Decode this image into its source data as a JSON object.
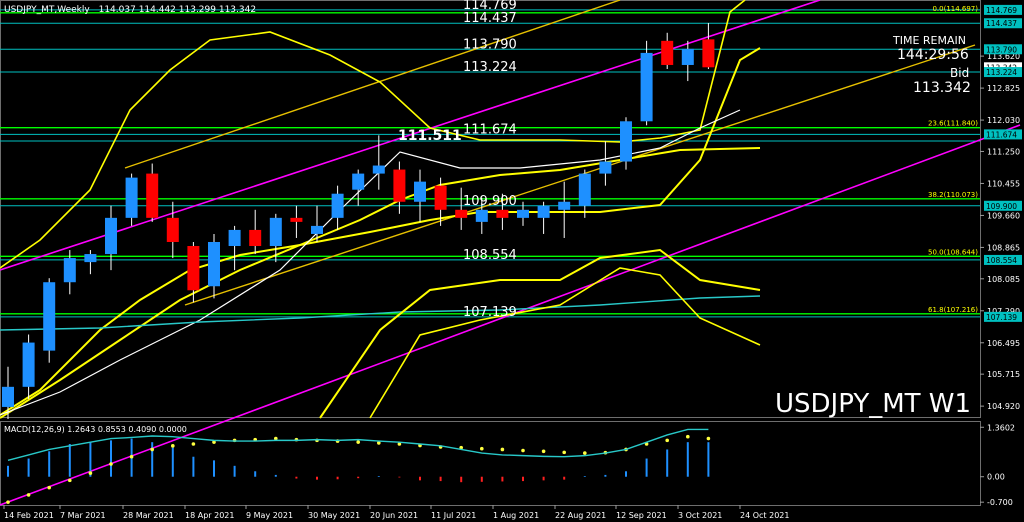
{
  "header": {
    "symbol_info": "USDJPY_MT,Weekly",
    "ohlc": "114.037 114.442 113.299 113.342"
  },
  "watermark": "USDJPY_MT W1",
  "info": {
    "time_remain_label": "TIME REMAIN",
    "time_remain": "144:29:56",
    "bid_label": "Bid",
    "bid": "113.342"
  },
  "macd": {
    "label": "MACD(12,26,9) 1.2643 0.8553 0.4090 0.0000",
    "ticks": [
      "1.3602",
      "0.00",
      "-0.700"
    ]
  },
  "colors": {
    "background": "#000000",
    "bull": "#1e90ff",
    "bear": "#ff0000",
    "bands": "#ffff00",
    "trendline_magenta": "#ff00ff",
    "level_line": "#00c0c0",
    "fib_line": "#00ff00"
  },
  "chart_data": {
    "type": "candlestick",
    "x_ticks": [
      "14 Feb 2021",
      "7 Mar 2021",
      "28 Mar 2021",
      "18 Apr 2021",
      "9 May 2021",
      "30 May 2021",
      "20 Jun 2021",
      "11 Jul 2021",
      "1 Aug 2021",
      "22 Aug 2021",
      "12 Sep 2021",
      "3 Oct 2021",
      "24 Oct 2021"
    ],
    "y_ticks": [
      104.92,
      105.715,
      106.495,
      107.29,
      108.085,
      108.865,
      109.66,
      110.455,
      111.25,
      112.03,
      112.825,
      113.62
    ],
    "ylim": [
      104.65,
      114.99
    ],
    "candles": [
      {
        "o": 104.9,
        "h": 105.9,
        "l": 104.6,
        "c": 105.4
      },
      {
        "o": 105.4,
        "h": 106.7,
        "l": 105.1,
        "c": 106.5
      },
      {
        "o": 106.3,
        "h": 108.1,
        "l": 106.0,
        "c": 108.0
      },
      {
        "o": 108.0,
        "h": 108.8,
        "l": 107.7,
        "c": 108.6
      },
      {
        "o": 108.5,
        "h": 108.8,
        "l": 108.2,
        "c": 108.7
      },
      {
        "o": 108.7,
        "h": 109.9,
        "l": 108.3,
        "c": 109.6
      },
      {
        "o": 109.6,
        "h": 110.7,
        "l": 109.4,
        "c": 110.6
      },
      {
        "o": 110.7,
        "h": 110.95,
        "l": 109.5,
        "c": 109.6
      },
      {
        "o": 109.6,
        "h": 110.0,
        "l": 108.6,
        "c": 109.0
      },
      {
        "o": 108.9,
        "h": 109.0,
        "l": 107.5,
        "c": 107.8
      },
      {
        "o": 107.9,
        "h": 109.2,
        "l": 107.6,
        "c": 109.0
      },
      {
        "o": 108.9,
        "h": 109.4,
        "l": 108.3,
        "c": 109.3
      },
      {
        "o": 109.3,
        "h": 109.8,
        "l": 108.7,
        "c": 108.9
      },
      {
        "o": 108.9,
        "h": 109.7,
        "l": 108.5,
        "c": 109.6
      },
      {
        "o": 109.6,
        "h": 109.9,
        "l": 109.1,
        "c": 109.5
      },
      {
        "o": 109.2,
        "h": 109.9,
        "l": 109.0,
        "c": 109.4
      },
      {
        "o": 109.6,
        "h": 110.4,
        "l": 109.3,
        "c": 110.2
      },
      {
        "o": 110.3,
        "h": 110.8,
        "l": 109.9,
        "c": 110.7
      },
      {
        "o": 110.7,
        "h": 111.65,
        "l": 110.3,
        "c": 110.9
      },
      {
        "o": 110.8,
        "h": 111.0,
        "l": 109.7,
        "c": 110.0
      },
      {
        "o": 110.0,
        "h": 110.8,
        "l": 109.5,
        "c": 110.5
      },
      {
        "o": 110.4,
        "h": 110.6,
        "l": 109.4,
        "c": 109.8
      },
      {
        "o": 109.8,
        "h": 110.35,
        "l": 109.3,
        "c": 109.6
      },
      {
        "o": 109.5,
        "h": 110.1,
        "l": 109.2,
        "c": 109.8
      },
      {
        "o": 109.8,
        "h": 110.2,
        "l": 109.3,
        "c": 109.6
      },
      {
        "o": 109.6,
        "h": 110.0,
        "l": 109.4,
        "c": 109.8
      },
      {
        "o": 109.6,
        "h": 110.0,
        "l": 109.2,
        "c": 109.9
      },
      {
        "o": 109.8,
        "h": 110.5,
        "l": 109.1,
        "c": 110.0
      },
      {
        "o": 109.9,
        "h": 110.8,
        "l": 109.6,
        "c": 110.7
      },
      {
        "o": 110.7,
        "h": 111.5,
        "l": 110.4,
        "c": 111.0
      },
      {
        "o": 111.0,
        "h": 112.1,
        "l": 110.8,
        "c": 112.0
      },
      {
        "o": 112.0,
        "h": 114.0,
        "l": 111.9,
        "c": 113.7
      },
      {
        "o": 114.0,
        "h": 114.2,
        "l": 113.3,
        "c": 113.4
      },
      {
        "o": 113.4,
        "h": 114.0,
        "l": 113.0,
        "c": 113.8
      },
      {
        "o": 114.037,
        "h": 114.442,
        "l": 113.299,
        "c": 113.342
      }
    ],
    "levels": [
      {
        "value": 114.769,
        "label": "114.769"
      },
      {
        "value": 114.437,
        "label": "114.437"
      },
      {
        "value": 113.79,
        "label": "113.790"
      },
      {
        "value": 113.224,
        "label": "113.224"
      },
      {
        "value": 111.674,
        "label": "111.674"
      },
      {
        "value": 111.511,
        "label": "111.511"
      },
      {
        "value": 109.9,
        "label": "109.900"
      },
      {
        "value": 108.554,
        "label": "108.554"
      },
      {
        "value": 107.139,
        "label": "107.139"
      }
    ],
    "fib_levels": [
      {
        "value": 114.697,
        "label": "0.0(114.697)"
      },
      {
        "value": 111.84,
        "label": "23.6(111.840)"
      },
      {
        "value": 110.073,
        "label": "38.2(110.073)"
      },
      {
        "value": 108.644,
        "label": "50.0(108.644)"
      },
      {
        "value": 107.216,
        "label": "61.8(107.216)"
      }
    ],
    "price_tags": [
      {
        "value": 114.769,
        "label": "114.769",
        "color": "#00c0c0"
      },
      {
        "value": 114.437,
        "label": "114.437",
        "color": "#00c0c0"
      },
      {
        "value": 113.79,
        "label": "113.790",
        "color": "#00c0c0"
      },
      {
        "value": 113.342,
        "label": "113.342",
        "color": "#ffffff"
      },
      {
        "value": 113.224,
        "label": "113.224",
        "color": "#00c0c0"
      },
      {
        "value": 111.674,
        "label": "111.674",
        "color": "#00c0c0"
      },
      {
        "value": 109.9,
        "label": "109.900",
        "color": "#00c0c0"
      },
      {
        "value": 108.554,
        "label": "108.554",
        "color": "#00c0c0"
      },
      {
        "value": 107.139,
        "label": "107.139",
        "color": "#00c0c0"
      }
    ],
    "macd_hist": [
      0.3,
      0.5,
      0.7,
      0.9,
      0.95,
      1.0,
      1.05,
      0.95,
      0.8,
      0.55,
      0.45,
      0.3,
      0.15,
      0.05,
      -0.05,
      -0.08,
      -0.07,
      -0.04,
      0.02,
      -0.02,
      -0.1,
      -0.12,
      -0.15,
      -0.14,
      -0.13,
      -0.12,
      -0.1,
      -0.08,
      0.02,
      0.05,
      0.15,
      0.5,
      0.75,
      0.95,
      0.95
    ],
    "macd_signal": [
      -0.7,
      -0.5,
      -0.3,
      -0.1,
      0.1,
      0.35,
      0.55,
      0.75,
      0.85,
      0.9,
      0.95,
      1.0,
      1.02,
      1.05,
      1.02,
      1.0,
      0.98,
      0.95,
      0.93,
      0.9,
      0.86,
      0.82,
      0.8,
      0.77,
      0.75,
      0.72,
      0.7,
      0.67,
      0.65,
      0.66,
      0.75,
      0.9,
      1.0,
      1.1,
      1.05
    ],
    "macd_line": [
      0.45,
      0.6,
      0.75,
      0.85,
      0.95,
      1.05,
      1.08,
      1.12,
      1.1,
      1.05,
      1.0,
      0.98,
      0.98,
      1.0,
      1.0,
      1.02,
      1.0,
      1.02,
      0.98,
      0.95,
      0.9,
      0.85,
      0.75,
      0.65,
      0.6,
      0.58,
      0.56,
      0.55,
      0.58,
      0.65,
      0.75,
      0.95,
      1.15,
      1.3,
      1.3
    ]
  }
}
